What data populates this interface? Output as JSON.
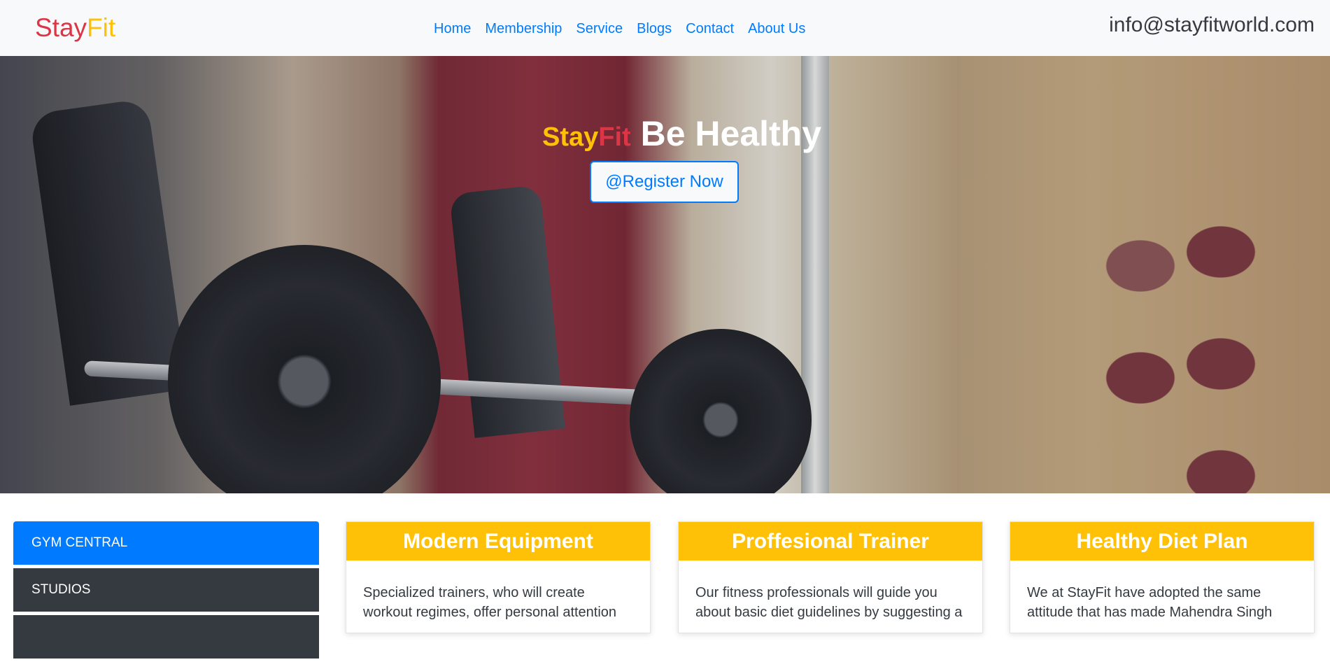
{
  "navbar": {
    "brand": {
      "part1": "Stay",
      "part2": "Fit"
    },
    "links": [
      {
        "label": "Home"
      },
      {
        "label": "Membership"
      },
      {
        "label": "Service"
      },
      {
        "label": "Blogs"
      },
      {
        "label": "Contact"
      },
      {
        "label": "About Us"
      }
    ],
    "email": "info@stayfitworld.com"
  },
  "hero": {
    "title_part1": "Stay",
    "title_part2": "Fit",
    "title_part3": "Be Healthy",
    "button_label": "@Register Now"
  },
  "sidebar": {
    "items": [
      {
        "label": "GYM CENTRAL"
      },
      {
        "label": "STUDIOS"
      },
      {
        "label": ""
      }
    ]
  },
  "cards": [
    {
      "title": "Modern Equipment",
      "text": "Specialized trainers, who will create workout regimes, offer personal attention"
    },
    {
      "title": "Proffesional Trainer",
      "text": "Our fitness professionals will guide you about basic diet guidelines by suggesting a"
    },
    {
      "title": "Healthy Diet Plan",
      "text": "We at StayFit have adopted the same attitude that has made Mahendra Singh"
    }
  ],
  "colors": {
    "primary": "#007bff",
    "warning": "#ffc107",
    "danger": "#dc3545",
    "dark": "#343a40",
    "light": "#f8f9fa"
  }
}
